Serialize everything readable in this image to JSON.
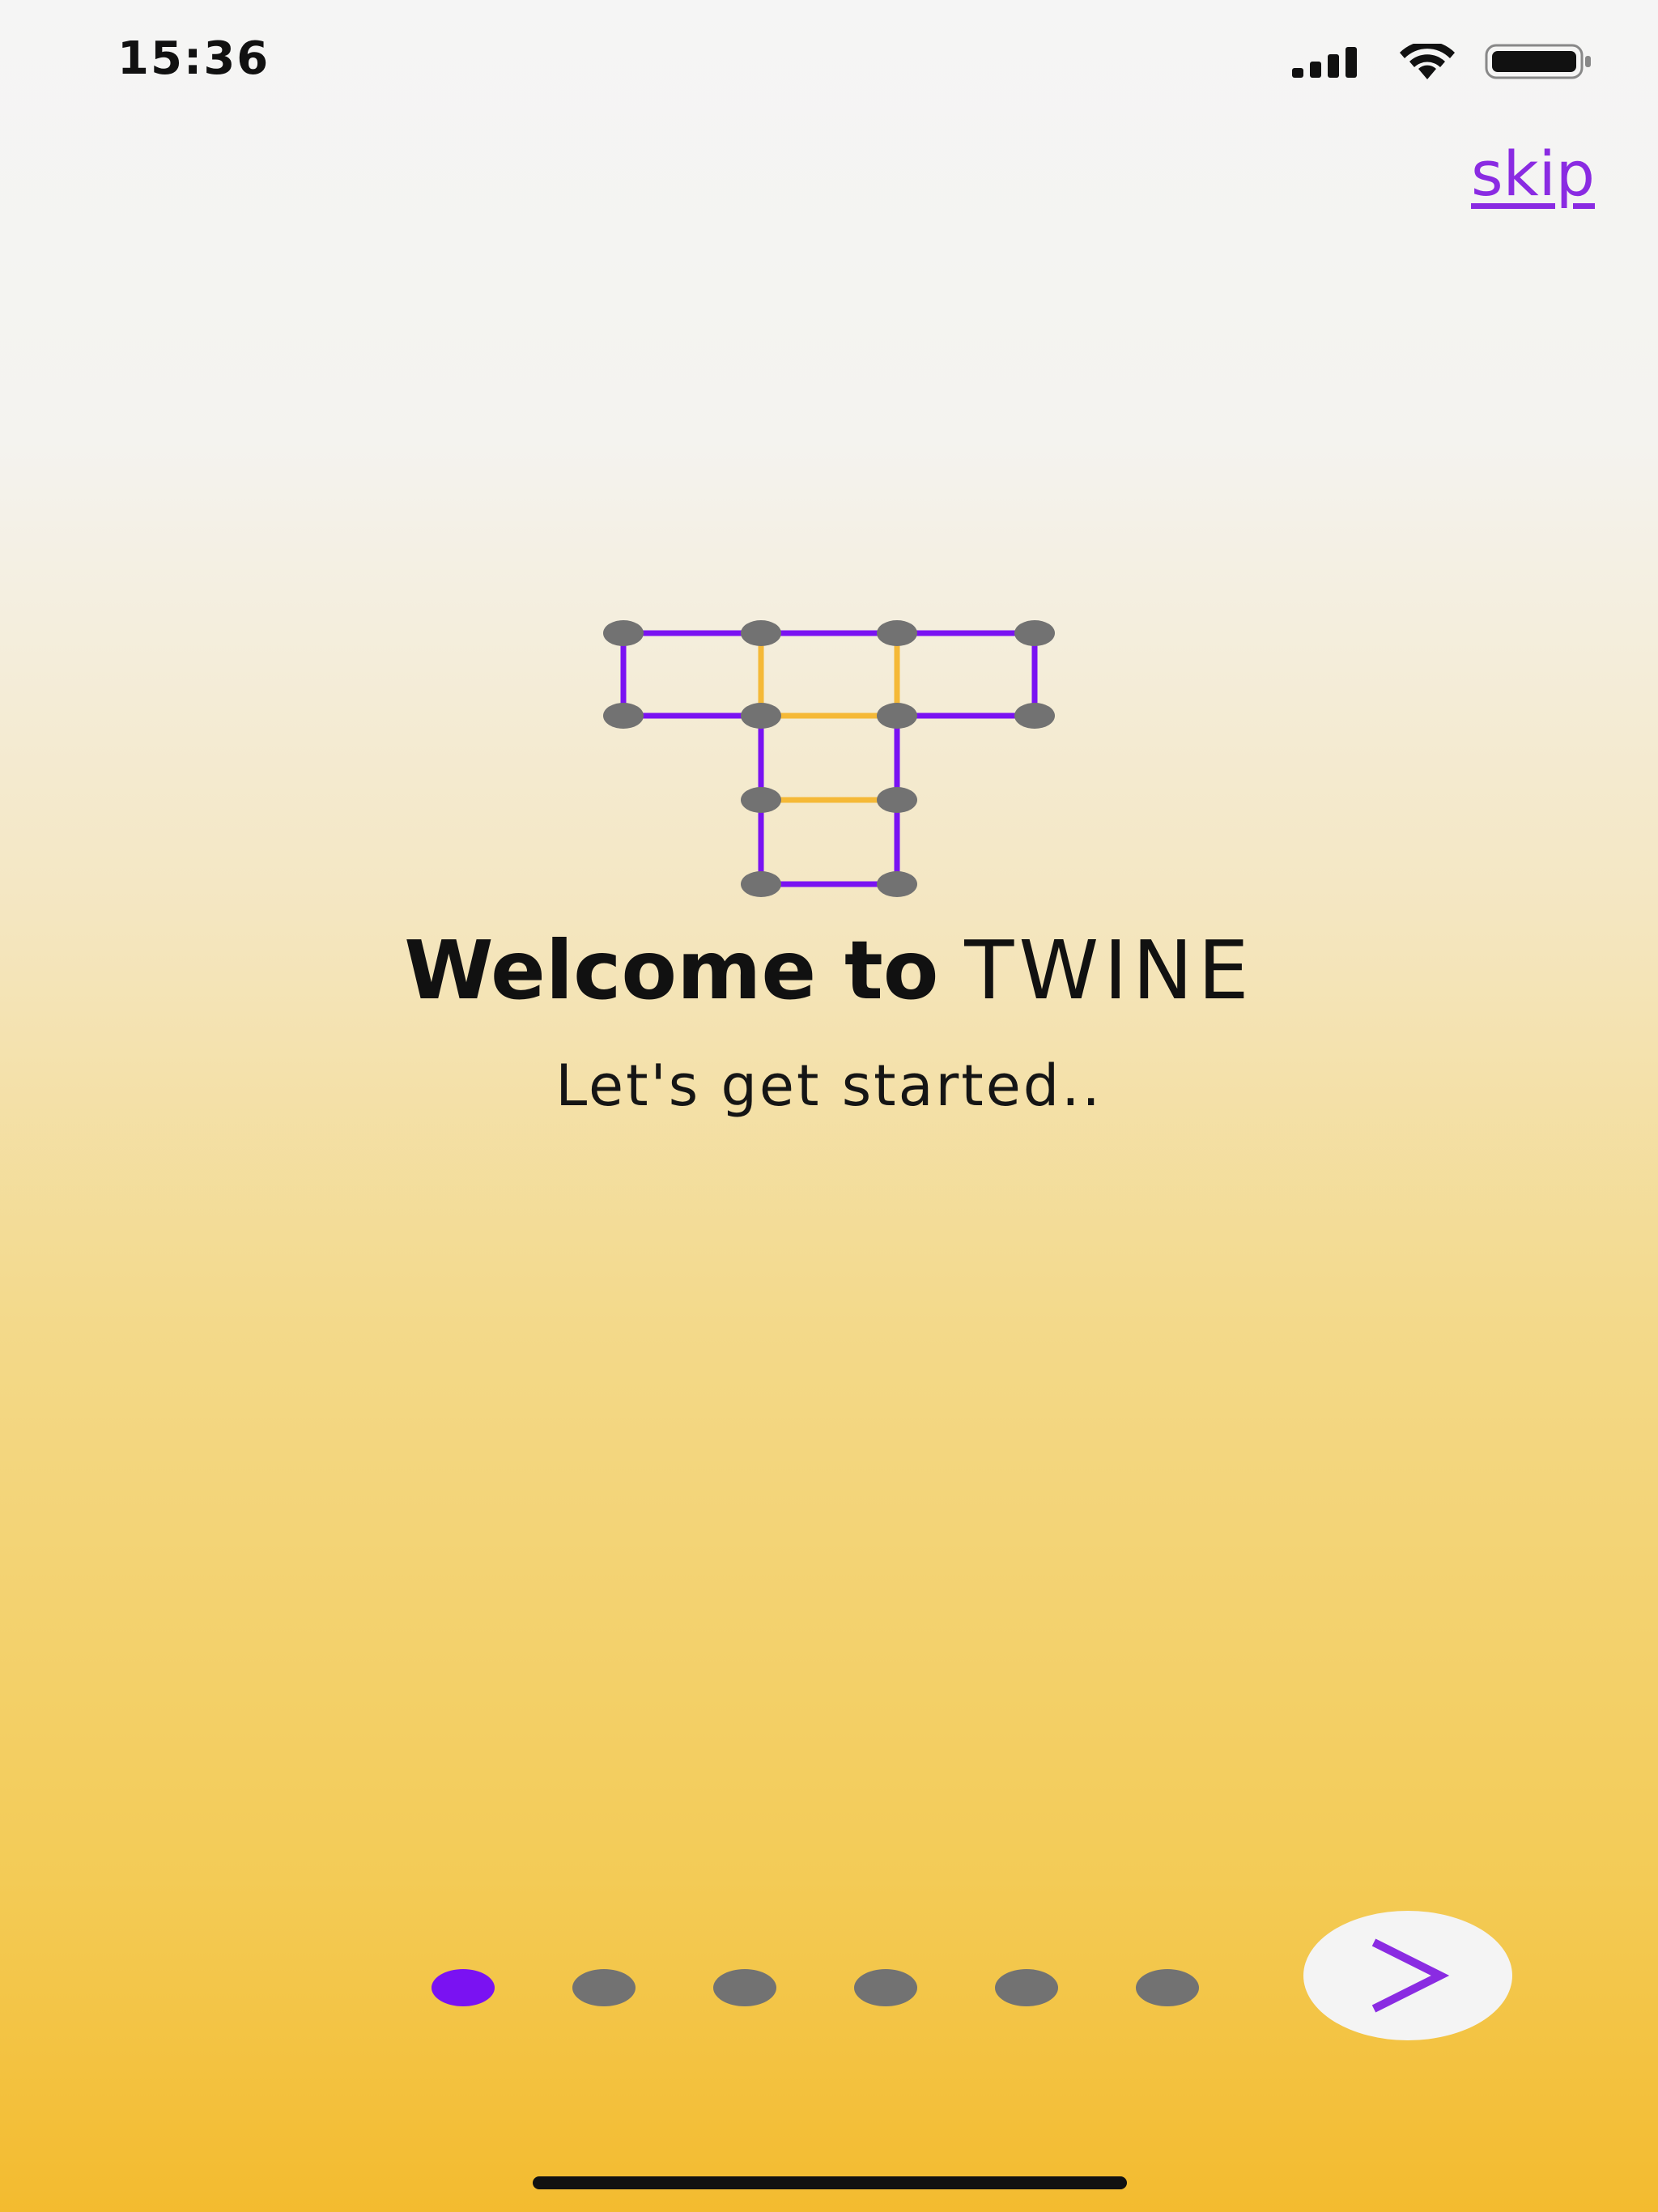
{
  "status_bar": {
    "time": "15:36",
    "icons": [
      "signal-icon",
      "wifi-icon",
      "battery-icon"
    ]
  },
  "header": {
    "skip_label": "skip"
  },
  "welcome": {
    "prefix": "Welcome to",
    "brand": "TWINE",
    "subtitle": "Let's get started.."
  },
  "pagination": {
    "total_pages": 6,
    "current_page": 1
  },
  "next_button": {
    "label": ">"
  },
  "colors": {
    "accent": "#7a12f2",
    "link": "#8a2be2",
    "logo_yellow": "#f5b937",
    "dot_inactive": "#727272",
    "background_top": "#f5f5f5",
    "background_bottom": "#f3bb2f"
  }
}
